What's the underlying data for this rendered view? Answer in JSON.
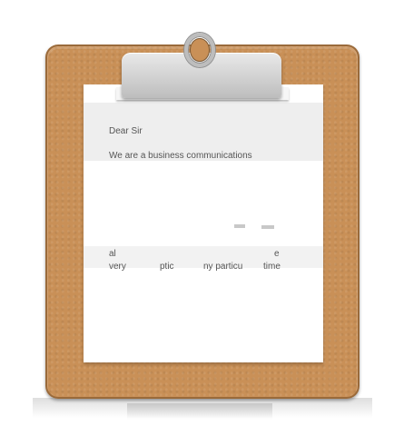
{
  "letter": {
    "greeting": "Dear Sir",
    "intro": "We are a business communications",
    "fragments": [
      "al",
      "e",
      "very",
      "ptic",
      "ny particu",
      "time"
    ]
  },
  "colors": {
    "board": "#c99057",
    "paper": "#ffffff",
    "clip": "#cfcfcf",
    "text": "#555555"
  }
}
